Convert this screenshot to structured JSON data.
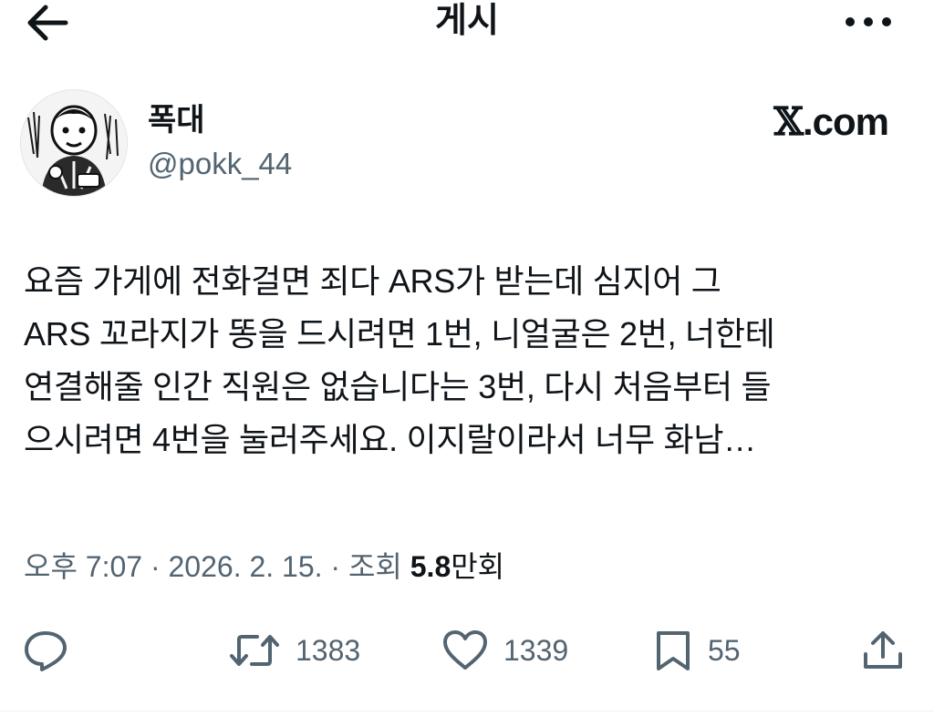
{
  "header": {
    "title": "게시"
  },
  "author": {
    "name": "폭대",
    "handle": "@pokk_44"
  },
  "source": {
    "brand_mark": "𝕏",
    "brand_suffix": ".com"
  },
  "tweet": {
    "lines": [
      "요즘 가게에 전화걸면 죄다 ARS가 받는데 심지어 그",
      "ARS 꼬라지가 똥을 드시려면 1번, 니얼굴은 2번, 너한테",
      "연결해줄 인간 직원은 없습니다는 3번, 다시 처음부터 들",
      "으시려면 4번을 눌러주세요. 이지랄이라서 너무 화남…"
    ]
  },
  "meta": {
    "time": "오후 7:07",
    "separator": " · ",
    "date": "2026. 2. 15.",
    "views_label": "조회",
    "views_value": "5.8",
    "views_unit": "만회"
  },
  "actions": {
    "retweet_count": "1383",
    "like_count": "1339",
    "bookmark_count": "55"
  },
  "icons": [
    "back-arrow-icon",
    "more-options-icon",
    "reply-icon",
    "retweet-icon",
    "like-icon",
    "bookmark-icon",
    "share-icon"
  ],
  "colors": {
    "text": "#0f1419",
    "secondary": "#536471",
    "background": "#ffffff"
  }
}
